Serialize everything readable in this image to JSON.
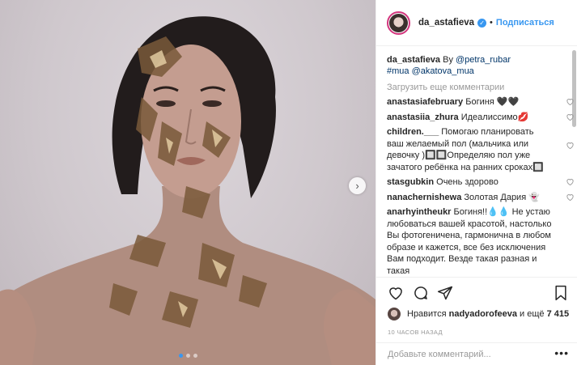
{
  "post": {
    "username": "da_astafieva",
    "separator": "•",
    "follow_label": "Подписаться",
    "next_icon": "chevron-right-icon"
  },
  "caption": {
    "author": "da_astafieva",
    "by": "By",
    "mention1": "@petra_rubar",
    "tag": "#mua",
    "mention2": "@akatova_mua"
  },
  "load_more": "Загрузить еще комментарии",
  "comments": [
    {
      "user": "anastasiafebruary",
      "text": "Богиня 🖤🖤"
    },
    {
      "user": "anastasiia_zhura",
      "text": "Идеалиссимо💋"
    },
    {
      "user": "children.___",
      "text": "Помогаю планировать ваш желаемый пол (мальчика или девочку )🔲🔲Определяю пол уже зачатого ребёнка на ранних сроках🔲"
    },
    {
      "user": "stasgubkin",
      "text": "Очень здорово"
    },
    {
      "user": "nanachernishewa",
      "text": "Золотая Дария 👻"
    },
    {
      "user": "anarhyintheukr",
      "text": "Богиня!!💧💧 Не устаю любоваться вашей красотой, настолько Вы фотогеничена, гармонична в любом образе и кажется, все без исключения Вам подходит. Везде такая разная и такая"
    }
  ],
  "likes": {
    "prefix": "Нравится",
    "user": "nadyadorofeeva",
    "suffix": "и ещё",
    "count": "7 415"
  },
  "time": "10 ЧАСОВ НАЗАД",
  "add_comment_placeholder": "Добавьте комментарий...",
  "more_label": "•••",
  "colors": {
    "accent": "#3897f0",
    "text": "#262626",
    "muted": "#999999",
    "link": "#003569"
  }
}
